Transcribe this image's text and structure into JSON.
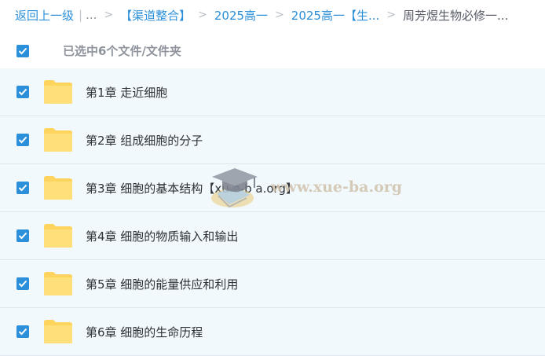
{
  "breadcrumb": {
    "back": "返回上一级",
    "ellipsis": "...",
    "items": [
      "【渠道整合】",
      "2025高一",
      "2025高一【生..."
    ],
    "current": "周芳煜生物必修一..."
  },
  "selection": {
    "checked": true,
    "text": "已选中6个文件/文件夹"
  },
  "files": [
    {
      "name": "第1章 走近细胞",
      "checked": true,
      "icon": "folder-icon"
    },
    {
      "name": "第2章 组成细胞的分子",
      "checked": true,
      "icon": "folder-icon"
    },
    {
      "name": "第3章 细胞的基本结构【xu e-b a.org】",
      "checked": true,
      "icon": "folder-icon"
    },
    {
      "name": "第4章 细胞的物质输入和输出",
      "checked": true,
      "icon": "folder-icon"
    },
    {
      "name": "第5章 细胞的能量供应和利用",
      "checked": true,
      "icon": "folder-icon"
    },
    {
      "name": "第6章 细胞的生命历程",
      "checked": true,
      "icon": "folder-icon"
    }
  ],
  "watermark": {
    "text": "www.xue-ba.org"
  },
  "colors": {
    "accent": "#2b8fd9",
    "row_background": "#f2f9fd",
    "folder": "#ffd45e"
  }
}
